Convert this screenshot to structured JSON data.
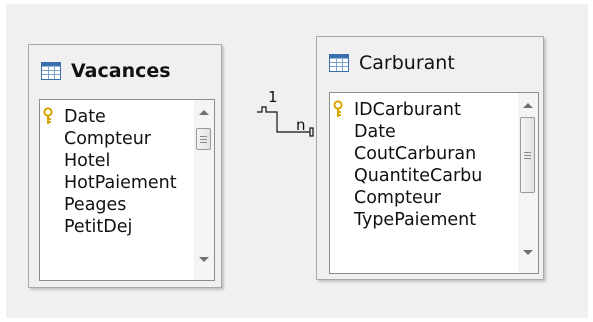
{
  "tables": [
    {
      "name": "Vacances",
      "icon": "table-icon",
      "fields": [
        {
          "label": "Date",
          "key": true
        },
        {
          "label": "Compteur",
          "key": false
        },
        {
          "label": "Hotel",
          "key": false
        },
        {
          "label": "HotPaiement",
          "key": false
        },
        {
          "label": "Peages",
          "key": false
        },
        {
          "label": "PetitDej",
          "key": false
        }
      ]
    },
    {
      "name": "Carburant",
      "icon": "table-icon",
      "fields": [
        {
          "label": "IDCarburant",
          "key": true
        },
        {
          "label": "Date",
          "key": false
        },
        {
          "label": "CoutCarburan",
          "key": false
        },
        {
          "label": "QuantiteCarbu",
          "key": false
        },
        {
          "label": "Compteur",
          "key": false
        },
        {
          "label": "TypePaiement",
          "key": false
        }
      ]
    }
  ],
  "relation": {
    "from_cardinality": "1",
    "to_cardinality": "n"
  },
  "colors": {
    "background": "#f0f0f0",
    "key_icon": "#d9a300",
    "table_icon": "#3a6fb0"
  }
}
